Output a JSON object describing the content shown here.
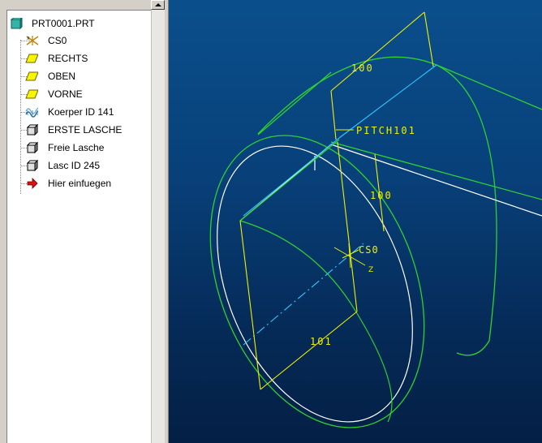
{
  "model_tree": {
    "root": {
      "label": "PRT0001.PRT"
    },
    "items": [
      {
        "label": "CS0",
        "icon": "coordinate-system-icon"
      },
      {
        "label": "RECHTS",
        "icon": "datum-plane-icon"
      },
      {
        "label": "OBEN",
        "icon": "datum-plane-icon"
      },
      {
        "label": "VORNE",
        "icon": "datum-plane-icon"
      },
      {
        "label": "Koerper ID 141",
        "icon": "surface-feature-icon"
      },
      {
        "label": "ERSTE LASCHE",
        "icon": "solid-feature-icon"
      },
      {
        "label": "Freie Lasche",
        "icon": "solid-feature-icon"
      },
      {
        "label": "Lasc ID 245",
        "icon": "solid-feature-icon"
      },
      {
        "label": "Hier einfuegen",
        "icon": "insert-here-arrow-icon"
      }
    ]
  },
  "viewport": {
    "dimension_top": "100",
    "pitch_label": "PITCH101",
    "dimension_vertical": "100",
    "csys_label": "CS0",
    "axis_label": "Z",
    "dimension_bottom": "101",
    "colors": {
      "background_top": "#0a4f8c",
      "background_bottom": "#041f45",
      "green_edges": "#2fd22f",
      "white_edges": "#ffffff",
      "yellow_dims": "#f0f000",
      "cyan_axis": "#33c8ff"
    }
  }
}
